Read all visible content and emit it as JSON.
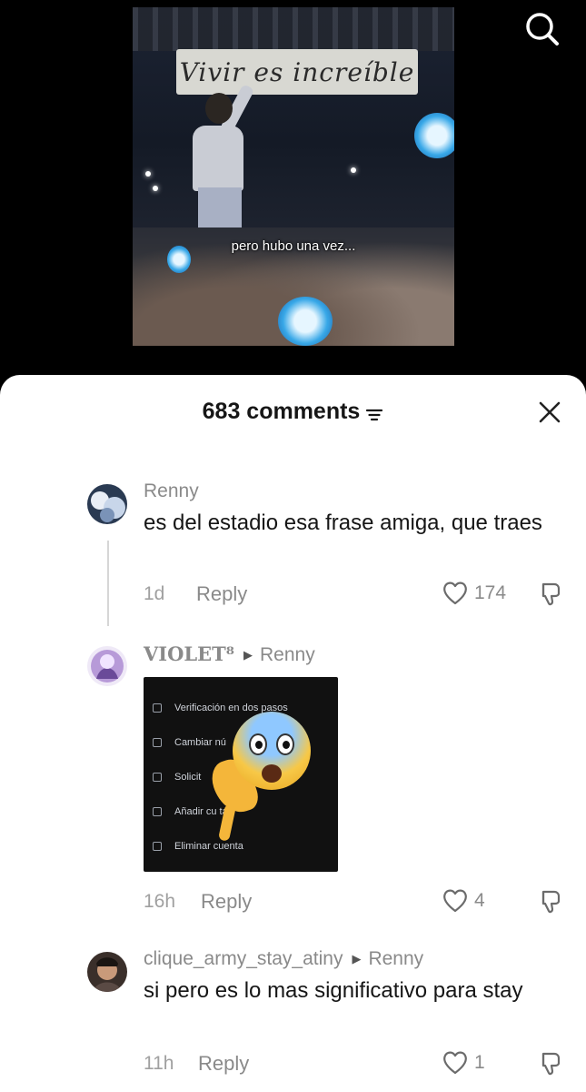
{
  "video": {
    "banner_text": "Vivir es increíble",
    "caption": "pero hubo una vez..."
  },
  "header": {
    "comment_count": "683 comments"
  },
  "comments": [
    {
      "username": "Renny",
      "reply_to": "",
      "text": "es del estadio esa frase amiga, que traes",
      "time": "1d",
      "reply_label": "Reply",
      "likes": "174"
    },
    {
      "username": "VIOLET⁸",
      "reply_to": "Renny",
      "text": "",
      "media": {
        "rows": [
          "Verificación en dos pasos",
          "Cambiar nú",
          "Solicit",
          "Añadir cu   ta",
          "Eliminar cuenta"
        ]
      },
      "time": "16h",
      "reply_label": "Reply",
      "likes": "4"
    },
    {
      "username": "clique_army_stay_atiny",
      "reply_to": "Renny",
      "text": "si pero es lo mas significativo para stay",
      "time": "11h",
      "reply_label": "Reply",
      "likes": "1"
    }
  ],
  "icons": {
    "search": "search-icon",
    "sort": "sort-icon",
    "close": "close-icon",
    "like": "heart-icon",
    "dislike": "dislike-icon",
    "reply_arrow": "play-arrow-icon"
  }
}
